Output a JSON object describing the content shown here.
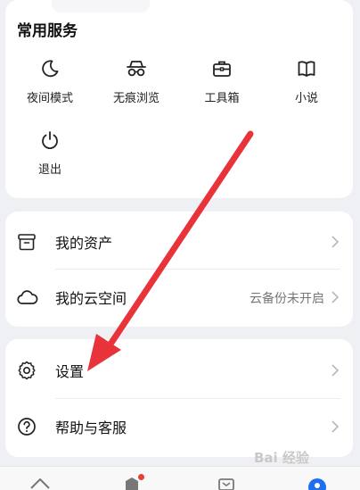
{
  "services": {
    "title": "常用服务",
    "items": [
      {
        "label": "夜间模式",
        "icon": "moon-icon"
      },
      {
        "label": "无痕浏览",
        "icon": "incognito-icon"
      },
      {
        "label": "工具箱",
        "icon": "toolbox-icon"
      },
      {
        "label": "小说",
        "icon": "book-icon"
      },
      {
        "label": "退出",
        "icon": "power-icon"
      }
    ]
  },
  "list1": [
    {
      "label": "我的资产",
      "icon": "box-icon",
      "value": ""
    },
    {
      "label": "我的云空间",
      "icon": "cloud-icon",
      "value": "云备份未开启"
    }
  ],
  "list2": [
    {
      "label": "设置",
      "icon": "gear-icon"
    },
    {
      "label": "帮助与客服",
      "icon": "help-icon"
    }
  ],
  "annotation": {
    "color": "#e8333a"
  },
  "watermark": "Bai 经验"
}
